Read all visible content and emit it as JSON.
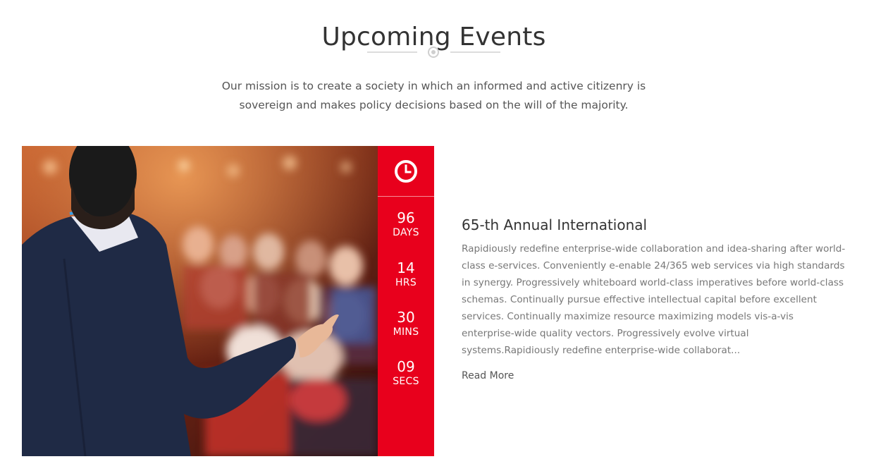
{
  "section": {
    "title": "Upcoming Events",
    "intro": "Our mission is to create a society in which an informed and active citizenry is sovereign and makes policy decisions based on the will of the majority."
  },
  "event": {
    "image_icon": "conference-speaker-photo",
    "title": "65-th Annual International",
    "description": "Rapidiously redefine enterprise-wide collaboration and idea-sharing after world-class e-services. Conveniently e-enable 24/365 web services via high standards in synergy. Progressively whiteboard world-class imperatives before world-class schemas. Continually pursue effective intellectual capital before excellent services. Continually maximize resource maximizing models vis-a-vis enterprise-wide quality vectors. Progressively evolve virtual systems.Rapidiously redefine enterprise-wide collaborat...",
    "read_more": "Read More"
  },
  "countdown": {
    "icon": "clock-icon",
    "days": {
      "value": "96",
      "label": "DAYS"
    },
    "hours": {
      "value": "14",
      "label": "HRS"
    },
    "mins": {
      "value": "30",
      "label": "MINS"
    },
    "secs": {
      "value": "09",
      "label": "SECS"
    }
  },
  "colors": {
    "accent": "#e8001c",
    "heading": "#333333",
    "body_text": "#777777",
    "divider": "#dddddd"
  }
}
